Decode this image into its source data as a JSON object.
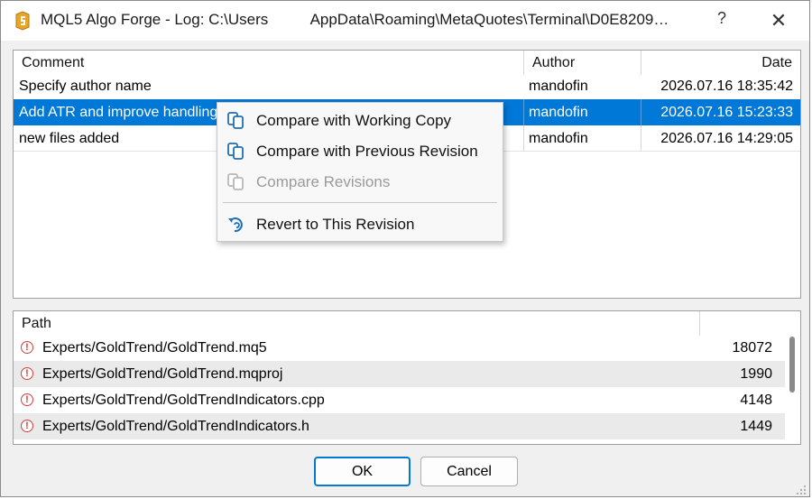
{
  "window": {
    "title": "MQL5 Algo Forge - Log: C:\\Users          AppData\\Roaming\\MetaQuotes\\Terminal\\D0E8209…",
    "help_label": "?",
    "close_label": "✕",
    "icon": "mql5-app-icon"
  },
  "log_table": {
    "columns": {
      "comment": "Comment",
      "author": "Author",
      "date": "Date"
    },
    "rows": [
      {
        "comment": "Specify author name",
        "author": "mandofin",
        "date": "2026.07.16 18:35:42"
      },
      {
        "comment": "Add ATR and improve handling",
        "author": "mandofin",
        "date": "2026.07.16 15:23:33"
      },
      {
        "comment": "new files added",
        "author": "mandofin",
        "date": "2026.07.16 14:29:05"
      }
    ]
  },
  "context_menu": {
    "items": [
      {
        "label": "Compare with Working Copy",
        "icon": "compare-icon"
      },
      {
        "label": "Compare with Previous Revision",
        "icon": "compare-icon"
      },
      {
        "label": "Compare Revisions",
        "icon": "compare-icon"
      },
      {
        "label": "Revert to This Revision",
        "icon": "revert-icon"
      }
    ]
  },
  "files_table": {
    "columns": {
      "path": "Path",
      "size": ""
    },
    "rows": [
      {
        "path": "Experts/GoldTrend/GoldTrend.mq5",
        "size": "18072"
      },
      {
        "path": "Experts/GoldTrend/GoldTrend.mqproj",
        "size": "1990"
      },
      {
        "path": "Experts/GoldTrend/GoldTrendIndicators.cpp",
        "size": "4148"
      },
      {
        "path": "Experts/GoldTrend/GoldTrendIndicators.h",
        "size": "1449"
      }
    ]
  },
  "buttons": {
    "ok": "OK",
    "cancel": "Cancel"
  },
  "colors": {
    "selection": "#0078d7",
    "error": "#d43c3c",
    "icon_blue": "#1f6fb5"
  }
}
